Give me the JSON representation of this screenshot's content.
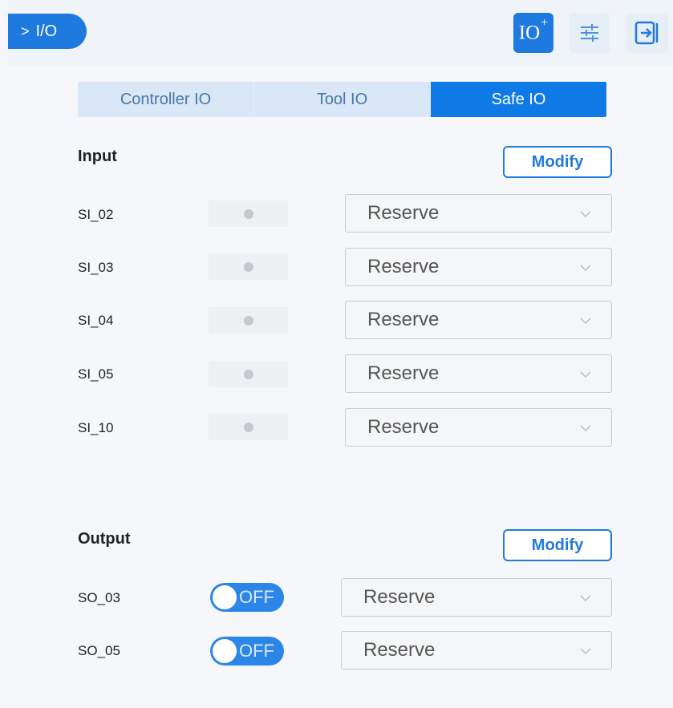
{
  "header": {
    "breadcrumb_chevron": ">",
    "breadcrumb_label": "I/O",
    "io_add_button_label": "IO",
    "io_add_button_plus": "+",
    "icons": [
      "io-add-icon",
      "sliders-icon",
      "exit-icon"
    ]
  },
  "tabs": [
    {
      "label": "Controller IO",
      "active": false
    },
    {
      "label": "Tool IO",
      "active": false
    },
    {
      "label": "Safe IO",
      "active": true
    }
  ],
  "input": {
    "title": "Input",
    "modify_label": "Modify",
    "rows": [
      {
        "label": "SI_02",
        "value": "Reserve"
      },
      {
        "label": "SI_03",
        "value": "Reserve"
      },
      {
        "label": "SI_04",
        "value": "Reserve"
      },
      {
        "label": "SI_05",
        "value": "Reserve"
      },
      {
        "label": "SI_10",
        "value": "Reserve"
      }
    ]
  },
  "output": {
    "title": "Output",
    "modify_label": "Modify",
    "rows": [
      {
        "label": "SO_03",
        "toggle": "OFF",
        "value": "Reserve"
      },
      {
        "label": "SO_05",
        "toggle": "OFF",
        "value": "Reserve"
      }
    ]
  },
  "colors": {
    "accent": "#1f7ae0",
    "active_tab": "#0f7ae5",
    "inactive_tab": "#d9e7f6"
  }
}
